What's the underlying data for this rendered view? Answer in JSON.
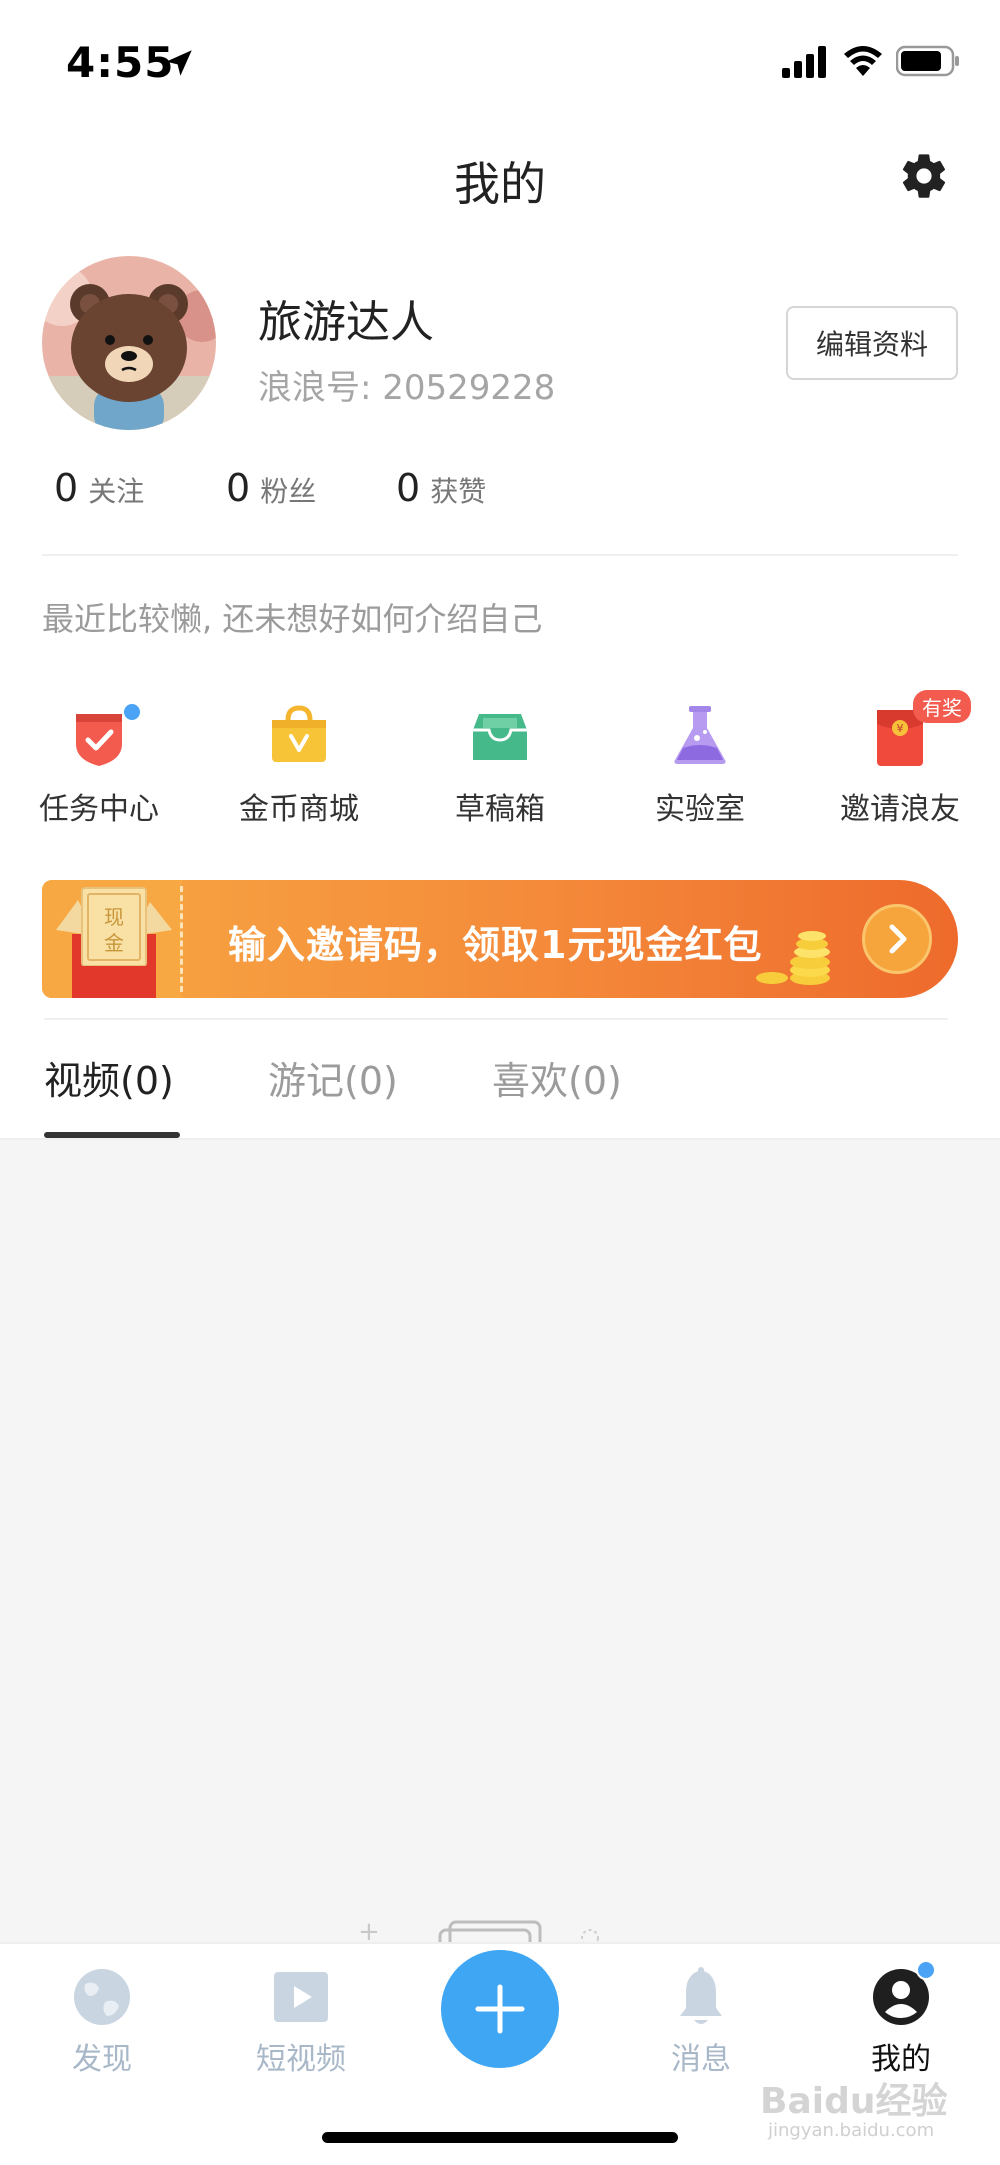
{
  "status_bar": {
    "time": "4:55"
  },
  "header": {
    "title": "我的"
  },
  "profile": {
    "username": "旅游达人",
    "user_id": "浪浪号: 20529228",
    "edit_label": "编辑资料",
    "bio": "最近比较懒, 还未想好如何介绍自己"
  },
  "stats": [
    {
      "value": "0",
      "label": "关注"
    },
    {
      "value": "0",
      "label": "粉丝"
    },
    {
      "value": "0",
      "label": "获赞"
    }
  ],
  "shortcuts": [
    {
      "label": "任务中心",
      "icon": "task-center-icon"
    },
    {
      "label": "金币商城",
      "icon": "coin-mall-icon"
    },
    {
      "label": "草稿箱",
      "icon": "drafts-icon"
    },
    {
      "label": "实验室",
      "icon": "lab-flask-icon"
    },
    {
      "label": "邀请浪友",
      "icon": "red-envelope-icon",
      "badge": "有奖"
    }
  ],
  "banner": {
    "text": "输入邀请码，领取1元现金红包",
    "envelope_text_1": "现",
    "envelope_text_2": "金"
  },
  "content_tabs": [
    "视频(0)",
    "游记(0)",
    "喜欢(0)"
  ],
  "bottom_nav": [
    {
      "label": "发现",
      "icon": "globe-icon"
    },
    {
      "label": "短视频",
      "icon": "video-play-icon"
    },
    {
      "label": "消息",
      "icon": "bell-icon"
    },
    {
      "label": "我的",
      "icon": "user-icon"
    }
  ],
  "watermark": {
    "text": "Baidu经验",
    "sub": "jingyan.baidu.com"
  },
  "colors": {
    "accent_blue": "#3fa6f3",
    "banner_orange": "#f48a3a",
    "badge_red": "#f25b4e"
  }
}
